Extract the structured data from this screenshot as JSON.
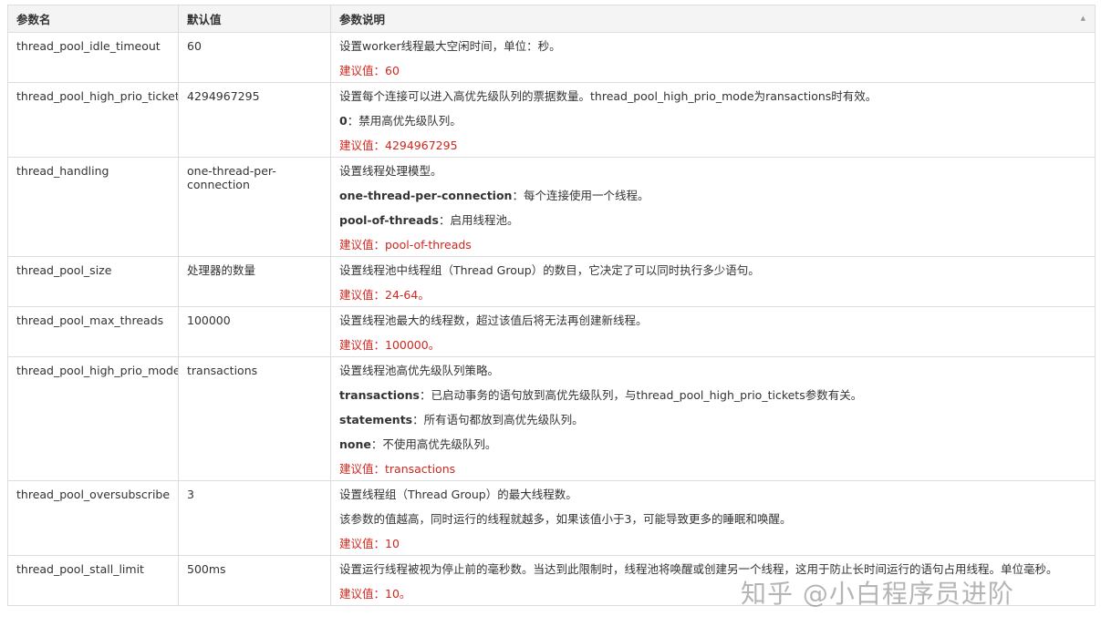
{
  "table": {
    "headers": {
      "name": "参数名",
      "default": "默认值",
      "desc": "参数说明"
    },
    "rows": [
      {
        "name": "thread_pool_idle_timeout",
        "default": "60",
        "lines": [
          {
            "kind": "plain",
            "text": "设置worker线程最大空闲时间，单位：秒。"
          },
          {
            "kind": "recommend",
            "text": "建议值：60"
          }
        ]
      },
      {
        "name": "thread_pool_high_prio_tickets",
        "default": "4294967295",
        "lines": [
          {
            "kind": "plain",
            "text": "设置每个连接可以进入高优先级队列的票据数量。thread_pool_high_prio_mode为ransactions时有效。"
          },
          {
            "kind": "term",
            "term": "0",
            "text": "：禁用高优先级队列。"
          },
          {
            "kind": "recommend",
            "text": "建议值：4294967295"
          }
        ]
      },
      {
        "name": "thread_handling",
        "default": "one-thread-per-connection",
        "lines": [
          {
            "kind": "plain",
            "text": "设置线程处理模型。"
          },
          {
            "kind": "term",
            "term": "one-thread-per-connection",
            "text": "：每个连接使用一个线程。"
          },
          {
            "kind": "term",
            "term": "pool-of-threads",
            "text": "：启用线程池。"
          },
          {
            "kind": "recommend",
            "text": "建议值：pool-of-threads"
          }
        ]
      },
      {
        "name": "thread_pool_size",
        "default": "处理器的数量",
        "lines": [
          {
            "kind": "plain",
            "text": "设置线程池中线程组（Thread Group）的数目，它决定了可以同时执行多少语句。"
          },
          {
            "kind": "recommend",
            "text": "建议值：24-64。"
          }
        ]
      },
      {
        "name": "thread_pool_max_threads",
        "default": "100000",
        "lines": [
          {
            "kind": "plain",
            "text": "设置线程池最大的线程数，超过该值后将无法再创建新线程。"
          },
          {
            "kind": "recommend",
            "text": "建议值：100000。"
          }
        ]
      },
      {
        "name": "thread_pool_high_prio_mode",
        "default": "transactions",
        "lines": [
          {
            "kind": "plain",
            "text": "设置线程池高优先级队列策略。"
          },
          {
            "kind": "term",
            "term": "transactions",
            "text": "：已启动事务的语句放到高优先级队列，与thread_pool_high_prio_tickets参数有关。"
          },
          {
            "kind": "term",
            "term": "statements",
            "text": "：所有语句都放到高优先级队列。"
          },
          {
            "kind": "term",
            "term": "none",
            "text": "：不使用高优先级队列。"
          },
          {
            "kind": "recommend",
            "text": "建议值：transactions"
          }
        ]
      },
      {
        "name": "thread_pool_oversubscribe",
        "default": "3",
        "lines": [
          {
            "kind": "plain",
            "text": "设置线程组（Thread Group）的最大线程数。"
          },
          {
            "kind": "plain",
            "text": "该参数的值越高，同时运行的线程就越多，如果该值小于3，可能导致更多的睡眠和唤醒。"
          },
          {
            "kind": "recommend",
            "text": "建议值：10"
          }
        ]
      },
      {
        "name": "thread_pool_stall_limit",
        "default": "500ms",
        "lines": [
          {
            "kind": "plain",
            "text": "设置运行线程被视为停止前的毫秒数。当达到此限制时，线程池将唤醒或创建另一个线程，这用于防止长时间运行的语句占用线程。单位毫秒。"
          },
          {
            "kind": "recommend",
            "text": "建议值：10。"
          }
        ]
      }
    ]
  },
  "watermark": "知乎 @小白程序员进阶"
}
